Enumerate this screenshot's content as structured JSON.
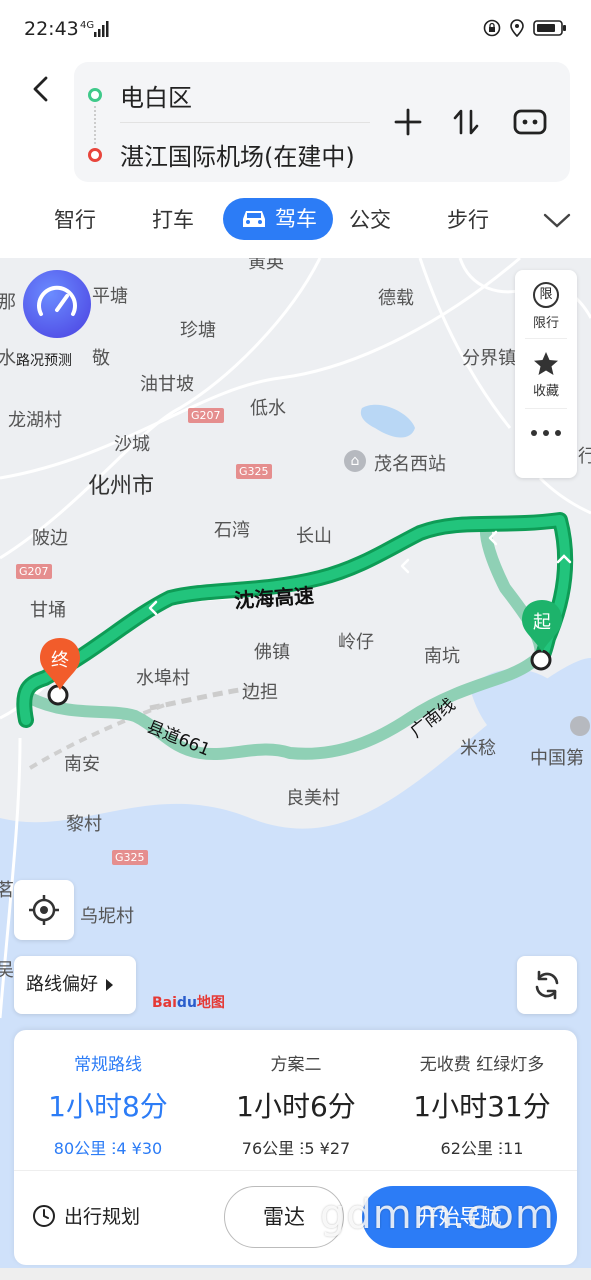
{
  "status": {
    "time": "22:43",
    "network": "4G"
  },
  "route": {
    "start": "电白区",
    "end": "湛江国际机场(在建中)"
  },
  "tabs": [
    {
      "label": "智行"
    },
    {
      "label": "打车"
    },
    {
      "label": "驾车",
      "active": true
    },
    {
      "label": "公交"
    },
    {
      "label": "步行"
    }
  ],
  "map": {
    "traffic_forecast_label": "路况预测",
    "side_panel": {
      "restrict_label": "限行",
      "restrict_icon_text": "限",
      "favorite_label": "收藏"
    },
    "places": [
      "平塘",
      "德载",
      "珍塘",
      "路况预测",
      "分界镇",
      "油甘坡",
      "低水",
      "龙湖村",
      "沙城",
      "茂名西站",
      "化州市",
      "石湾",
      "长山",
      "陂边",
      "甘埇",
      "佛镇",
      "岭仔",
      "南坑",
      "水埠村",
      "边担",
      "南安",
      "米稔",
      "中国第",
      "良美村",
      "黎村",
      "乌坭村"
    ],
    "places_clean": {
      "a": "平塘",
      "b": "德载",
      "c": "珍塘",
      "d": "分界镇",
      "e": "油甘坡",
      "f": "低水",
      "g": "龙湖村",
      "h": "沙城",
      "i": "茂名西站",
      "j": "化州市",
      "k": "石湾",
      "l": "长山",
      "m": "陂边",
      "n": "甘埇",
      "o": "佛镇",
      "p": "岭仔",
      "q": "南坑",
      "r": "水埠村",
      "s": "边担",
      "t": "南安",
      "u": "米稔",
      "v": "中国第",
      "w": "良美村",
      "x": "黎村",
      "y": "乌坭村",
      "z1": "那",
      "z2": "水",
      "z3": "敬",
      "z4": "黄英",
      "z5": "行",
      "z6": "茗",
      "z7": "吴"
    },
    "highways": [
      "G207",
      "G325",
      "G325",
      "G207",
      "G325"
    ],
    "roads": {
      "main": "沈海高速",
      "county": "县道661",
      "g_road": "广南线"
    },
    "start_marker": "起",
    "end_marker": "终",
    "route_pref_label": "路线偏好",
    "baidu_logo": {
      "bai": "Bai",
      "du": "du",
      "map": "地图"
    }
  },
  "plans": [
    {
      "name": "常规路线",
      "time": "1小时8分",
      "distance": "80公里",
      "lights": "4",
      "cost": "¥30",
      "active": true
    },
    {
      "name": "方案二",
      "time": "1小时6分",
      "distance": "76公里",
      "lights": "5",
      "cost": "¥27",
      "active": false
    },
    {
      "name": "无收费  红绿灯多",
      "time": "1小时31分",
      "distance": "62公里",
      "lights": "11",
      "cost": "",
      "active": false
    }
  ],
  "actions": {
    "trip_plan": "出行规划",
    "radar": "雷达",
    "start_nav": "开始导航"
  },
  "watermark": "gdmm.com",
  "colors": {
    "accent": "#2c7cf6",
    "route_main": "#1db36b",
    "route_alt": "#8fd0b5",
    "start": "#1db36b",
    "end": "#f25c2b"
  }
}
